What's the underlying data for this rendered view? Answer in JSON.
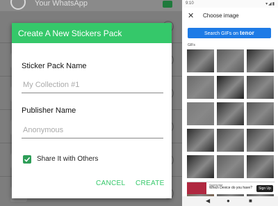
{
  "background_app": {
    "row_title": "Your WhatsApp"
  },
  "dialog": {
    "title": "Create A New Stickers Pack",
    "pack_name_label": "Sticker Pack Name",
    "pack_name_placeholder": "My Collection #1",
    "publisher_label": "Publisher Name",
    "publisher_placeholder": "Anonymous",
    "share_label": "Share It with Others",
    "share_checked": true,
    "cancel_label": "CANCEL",
    "create_label": "CREATE",
    "accent_color": "#35c86a"
  },
  "picker": {
    "status_time": "9:10",
    "title": "Choose image",
    "search_button_prefix": "Search GIFs on",
    "search_button_brand": "tenor",
    "section_label": "GIFs",
    "ad": {
      "tag": "Sponsored",
      "text": "Which Device do you have?",
      "cta": "Sign Up"
    }
  }
}
